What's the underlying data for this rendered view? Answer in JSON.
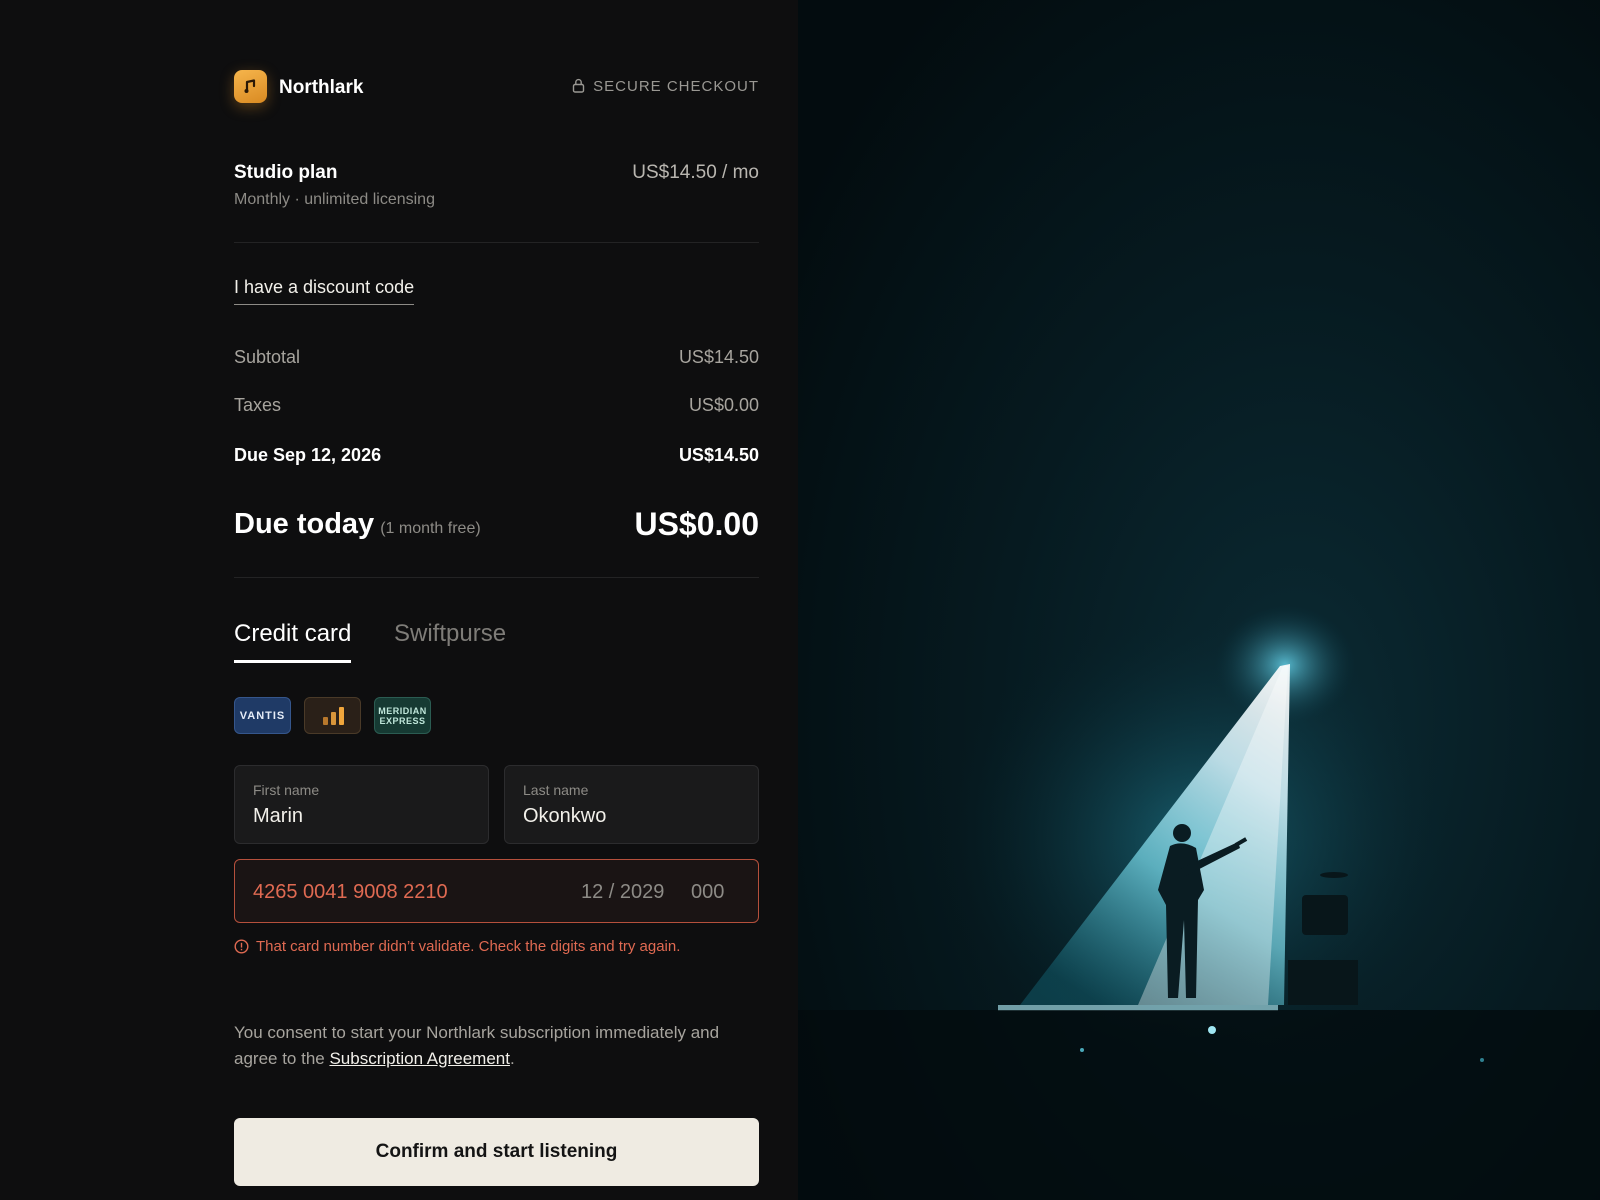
{
  "brand": {
    "name": "Northlark",
    "logo_icon": "music-note-icon"
  },
  "secure_label": "SECURE CHECKOUT",
  "plan": {
    "name": "Studio plan",
    "subtitle": "Monthly · unlimited licensing",
    "price": "US$14.50 / mo"
  },
  "discount_link": "I have a discount code",
  "summary": {
    "subtotal_label": "Subtotal",
    "subtotal_value": "US$14.50",
    "taxes_label": "Taxes",
    "taxes_value": "US$0.00",
    "due_label": "Due Sep 12, 2026",
    "due_value": "US$14.50",
    "today_label": "Due today",
    "today_note": "(1 month free)",
    "today_value": "US$0.00"
  },
  "tabs": {
    "credit_card": "Credit card",
    "swiftpurse": "Swiftpurse",
    "active": "Credit card"
  },
  "card_brands": {
    "vantis": "VANTIS",
    "meridian_line1": "MERIDIAN",
    "meridian_line2": "EXPRESS"
  },
  "form": {
    "first_name_label": "First name",
    "first_name_value": "Marin",
    "last_name_label": "Last name",
    "last_name_value": "Okonkwo",
    "card_number": "4265 0041 9008 2210",
    "expiry": "12 / 2029",
    "cvc": "000",
    "error": "That card number didn’t validate. Check the digits and try again."
  },
  "consent": {
    "before": "You consent to start your Northlark subscription immediately and agree to the ",
    "link": "Subscription Agreement",
    "after": "."
  },
  "cta_label": "Confirm and start listening",
  "colors": {
    "accent": "#f0a63c",
    "error": "#e06a52",
    "cta_bg": "#efebe2",
    "spotlight": "#3fd0e8"
  }
}
